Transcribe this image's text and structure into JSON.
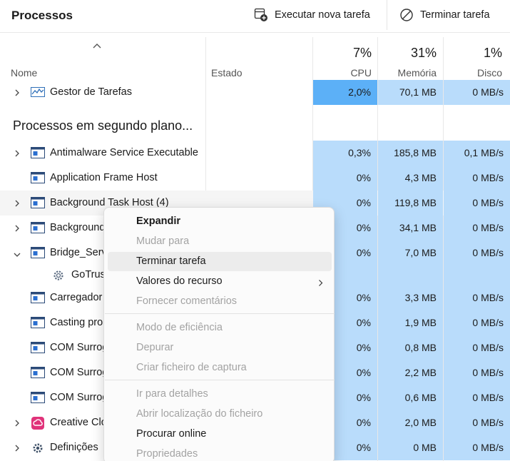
{
  "toolbar": {
    "title": "Processos",
    "new_task_label": "Executar nova tarefa",
    "end_task_label": "Terminar tarefa"
  },
  "columns": {
    "name": "Nome",
    "status": "Estado",
    "cpu_pct": "7%",
    "cpu_label": "CPU",
    "mem_pct": "31%",
    "mem_label": "Memória",
    "disk_pct": "1%",
    "disk_label": "Disco"
  },
  "apps": [
    {
      "name": "Gestor de Tarefas",
      "cpu": "2,0%",
      "mem": "70,1 MB",
      "disk": "0 MB/s",
      "icon": "task-manager-icon"
    }
  ],
  "background_group": "Processos em segundo plano...",
  "rows": [
    {
      "name": "Antimalware Service Executable",
      "cpu": "0,3%",
      "mem": "185,8 MB",
      "disk": "0,1 MB/s",
      "expand": true,
      "icon": "window-icon"
    },
    {
      "name": "Application Frame Host",
      "cpu": "0%",
      "mem": "4,3 MB",
      "disk": "0 MB/s",
      "expand": false,
      "icon": "window-icon"
    },
    {
      "name": "Background Task Host (4)",
      "cpu": "0%",
      "mem": "119,8 MB",
      "disk": "0 MB/s",
      "expand": true,
      "icon": "window-icon"
    },
    {
      "name": "Background",
      "cpu": "0%",
      "mem": "34,1 MB",
      "disk": "0 MB/s",
      "expand": true,
      "icon": "window-icon"
    },
    {
      "name": "Bridge_Serv",
      "cpu": "0%",
      "mem": "7,0 MB",
      "disk": "0 MB/s",
      "expand": "open",
      "icon": "window-icon"
    },
    {
      "name": "GoTrus",
      "cpu": "",
      "mem": "",
      "disk": "",
      "expand": false,
      "icon": "gear-icon",
      "child": true
    },
    {
      "name": "Carregador",
      "cpu": "0%",
      "mem": "3,3 MB",
      "disk": "0 MB/s",
      "expand": false,
      "icon": "window-icon"
    },
    {
      "name": "Casting pro",
      "cpu": "0%",
      "mem": "1,9 MB",
      "disk": "0 MB/s",
      "expand": false,
      "icon": "window-icon"
    },
    {
      "name": "COM Surrog",
      "cpu": "0%",
      "mem": "0,8 MB",
      "disk": "0 MB/s",
      "expand": false,
      "icon": "window-icon"
    },
    {
      "name": "COM Surrog",
      "cpu": "0%",
      "mem": "2,2 MB",
      "disk": "0 MB/s",
      "expand": false,
      "icon": "window-icon"
    },
    {
      "name": "COM Surrog",
      "cpu": "0%",
      "mem": "0,6 MB",
      "disk": "0 MB/s",
      "expand": false,
      "icon": "window-icon"
    },
    {
      "name": "Creative Clo",
      "cpu": "0%",
      "mem": "2,0 MB",
      "disk": "0 MB/s",
      "expand": true,
      "icon": "creative-cloud-icon"
    },
    {
      "name": "Definições",
      "cpu": "0%",
      "mem": "0 MB",
      "disk": "0 MB/s",
      "expand": true,
      "icon": "settings-gear-icon"
    }
  ],
  "context_menu": {
    "items": [
      {
        "label": "Expandir",
        "state": "bold"
      },
      {
        "label": "Mudar para",
        "state": "disabled"
      },
      {
        "label": "Terminar tarefa",
        "state": "hover"
      },
      {
        "label": "Valores do recurso",
        "state": "submenu"
      },
      {
        "label": "Fornecer comentários",
        "state": "disabled"
      },
      {
        "label": "Modo de eficiência",
        "state": "disabled"
      },
      {
        "label": "Depurar",
        "state": "disabled"
      },
      {
        "label": "Criar ficheiro de captura",
        "state": "disabled"
      },
      {
        "label": "Ir para detalhes",
        "state": "disabled"
      },
      {
        "label": "Abrir localização do ficheiro",
        "state": "disabled"
      },
      {
        "label": "Procurar online",
        "state": "normal"
      },
      {
        "label": "Propriedades",
        "state": "disabled"
      }
    ]
  },
  "colors": {
    "cpu_high": "#5cb0f7",
    "usage_light": "#b9dcfb"
  }
}
